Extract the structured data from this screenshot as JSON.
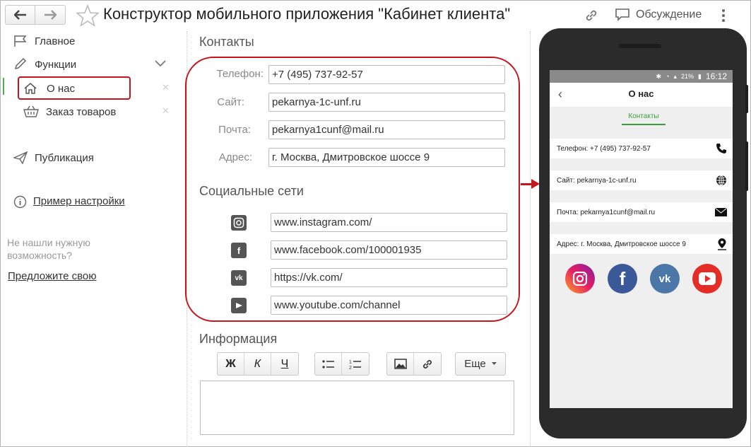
{
  "header": {
    "title": "Конструктор мобильного приложения \"Кабинет клиента\"",
    "discussion_label": "Обсуждение"
  },
  "sidebar": {
    "items": [
      {
        "label": "Главное"
      },
      {
        "label": "Функции"
      },
      {
        "label": "О нас"
      },
      {
        "label": "Заказ товаров"
      },
      {
        "label": "Публикация"
      },
      {
        "label": "Пример настройки"
      }
    ],
    "hint": "Не нашли нужную возможность?",
    "suggest_link": "Предложите свою"
  },
  "contacts": {
    "title": "Контакты",
    "fields": [
      {
        "label": "Телефон:",
        "value": "+7 (495) 737-92-57"
      },
      {
        "label": "Сайт:",
        "value": "pekarnya-1c-unf.ru"
      },
      {
        "label": "Почта:",
        "value": "pekarnya1cunf@mail.ru"
      },
      {
        "label": "Адрес:",
        "value": "г. Москва, Дмитровское шоссе 9"
      }
    ]
  },
  "social": {
    "title": "Социальные сети",
    "links": [
      {
        "network": "instagram",
        "value": "www.instagram.com/"
      },
      {
        "network": "facebook",
        "value": "www.facebook.com/100001935"
      },
      {
        "network": "vk",
        "value": "https://vk.com/"
      },
      {
        "network": "youtube",
        "value": "www.youtube.com/channel"
      }
    ]
  },
  "info": {
    "title": "Информация",
    "bold": "Ж",
    "italic": "К",
    "underline": "Ч",
    "more_label": "Еще"
  },
  "phone": {
    "time": "16:12",
    "battery": "21%",
    "screen_title": "О нас",
    "tab": "Контакты",
    "rows": [
      "Телефон: +7 (495) 737-92-57",
      "Сайт: pekarnya-1c-unf.ru",
      "Почта: pekarnya1cunf@mail.ru",
      "Адрес: г. Москва, Дмитровское шоссе 9"
    ]
  },
  "colors": {
    "highlight": "#c4161c",
    "active": "#4caf50",
    "instagram": "#c13584",
    "facebook": "#3b5998",
    "vk": "#4a76a8",
    "youtube": "#e52d27"
  }
}
